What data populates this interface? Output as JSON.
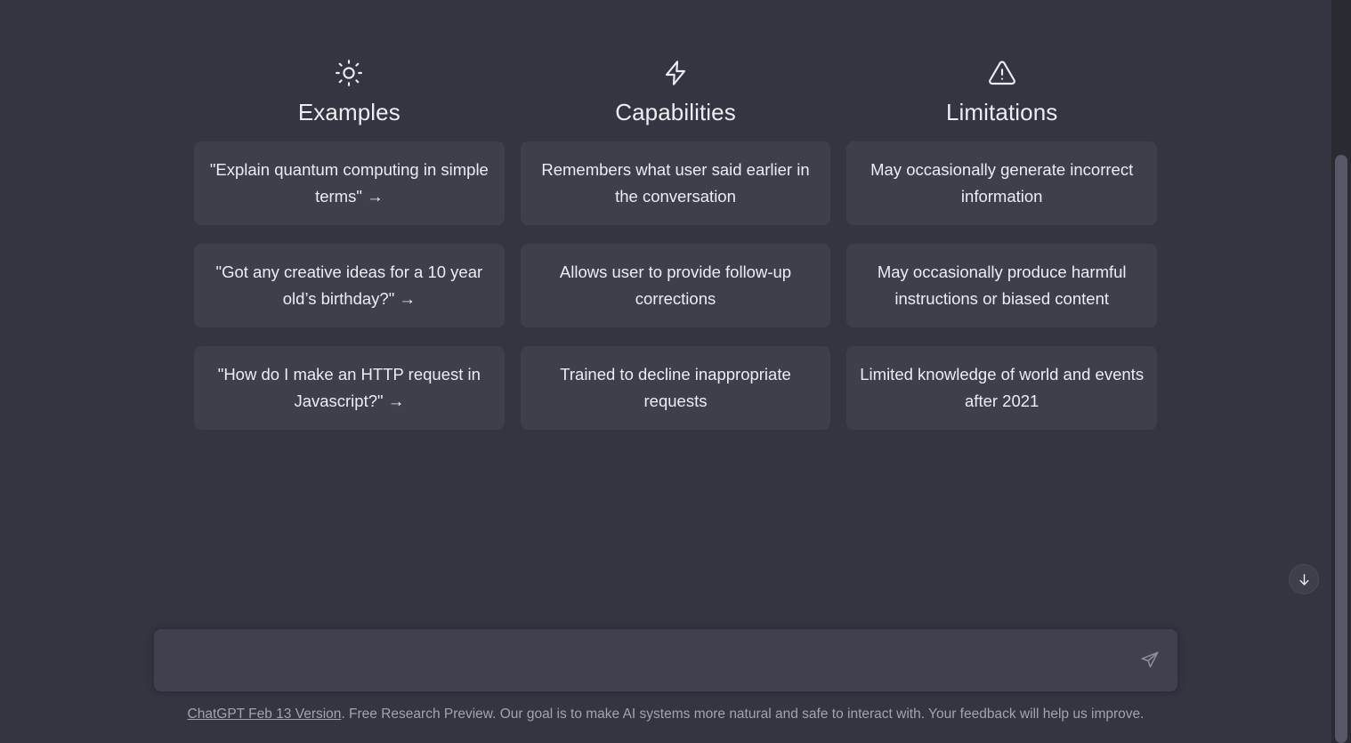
{
  "theme": {
    "page_bg": "#343541",
    "card_bg": "#3e3f4b",
    "composer_bg": "#40414f",
    "text": "#ececf1",
    "muted_text": "#a3a3b0",
    "scrollbar_track": "#2a2b32",
    "scrollbar_thumb": "#565869"
  },
  "columns": [
    {
      "icon": "sun-icon",
      "title": "Examples",
      "interactive_cards": true,
      "cards": [
        "\"Explain quantum computing in simple terms\" →",
        "\"Got any creative ideas for a 10 year old’s birthday?\" →",
        "\"How do I make an HTTP request in Javascript?\" →"
      ]
    },
    {
      "icon": "lightning-bolt-icon",
      "title": "Capabilities",
      "interactive_cards": false,
      "cards": [
        "Remembers what user said earlier in the conversation",
        "Allows user to provide follow-up corrections",
        "Trained to decline inappropriate requests"
      ]
    },
    {
      "icon": "warning-triangle-icon",
      "title": "Limitations",
      "interactive_cards": false,
      "cards": [
        "May occasionally generate incorrect information",
        "May occasionally produce harmful instructions or biased content",
        "Limited knowledge of world and events after 2021"
      ]
    }
  ],
  "composer": {
    "value": "",
    "placeholder": "",
    "send_icon": "send-paper-plane-icon"
  },
  "scroll_button": {
    "icon": "arrow-down-icon"
  },
  "footer": {
    "link_text": "ChatGPT Feb 13 Version",
    "rest_text": ". Free Research Preview. Our goal is to make AI systems more natural and safe to interact with. Your feedback will help us improve."
  }
}
